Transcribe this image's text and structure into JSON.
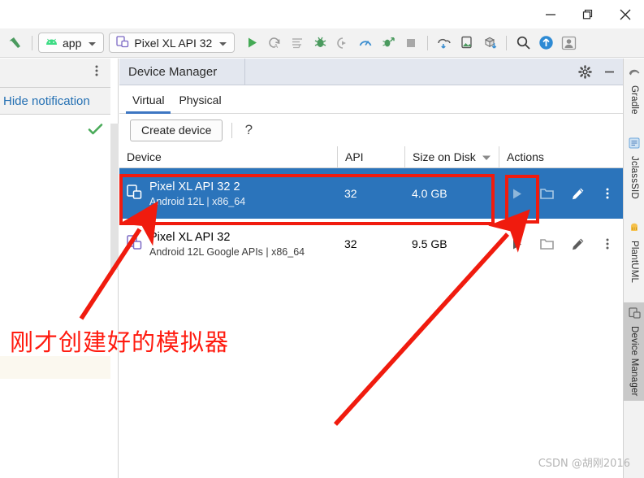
{
  "window": {
    "controls": [
      {
        "name": "minimize-button",
        "glyph": "minimize"
      },
      {
        "name": "restore-button",
        "glyph": "restore"
      },
      {
        "name": "close-button",
        "glyph": "close"
      }
    ]
  },
  "toolbar": {
    "build_icon": "hammer-icon",
    "module_selector": {
      "label": "app",
      "icon": "android-icon"
    },
    "device_selector": {
      "label": "Pixel XL API 32",
      "icon": "device-icon"
    },
    "icons": [
      "run-icon",
      "apply-changes-icon",
      "apply-code-changes-icon",
      "debug-icon",
      "attach-debugger-icon",
      "profiler-icon",
      "run-with-coverage-icon",
      "stop-icon",
      "sdk-manager-icon",
      "avd-manager-icon",
      "sync-project-icon",
      "search-icon",
      "update-icon",
      "account-icon"
    ]
  },
  "notification_panel": {
    "hide_label": "Hide notification",
    "more_icon": "more-vertical-icon",
    "status_icon": "check-icon"
  },
  "device_manager": {
    "title": "Device Manager",
    "settings_icon": "gear-icon",
    "minimize_icon": "minimize-icon",
    "tabs": [
      {
        "label": "Virtual",
        "active": true
      },
      {
        "label": "Physical",
        "active": false
      }
    ],
    "create_button": "Create device",
    "help_label": "?",
    "columns": [
      {
        "key": "device",
        "label": "Device"
      },
      {
        "key": "api",
        "label": "API"
      },
      {
        "key": "size",
        "label": "Size on Disk",
        "sorted": true,
        "sort_icon": "sort-desc-icon"
      },
      {
        "key": "actions",
        "label": "Actions"
      }
    ],
    "rows": [
      {
        "name": "Pixel XL API 32 2",
        "detail": "Android 12L | x86_64",
        "api": "32",
        "size": "4.0 GB",
        "selected": true,
        "icon": "virtual-device-icon",
        "actions": [
          "run-icon",
          "folder-icon",
          "edit-icon",
          "menu-icon"
        ]
      },
      {
        "name": "Pixel XL API 32",
        "detail": "Android 12L Google APIs | x86_64",
        "api": "32",
        "size": "9.5 GB",
        "selected": false,
        "icon": "virtual-device-icon",
        "actions": [
          "run-icon",
          "folder-icon",
          "edit-icon",
          "menu-icon"
        ]
      }
    ]
  },
  "right_tool_tabs": [
    {
      "label": "Gradle",
      "icon": "gradle-icon",
      "active": false
    },
    {
      "label": "JclassSID",
      "icon": "jclass-icon",
      "active": false
    },
    {
      "label": "PlantUML",
      "icon": "plantuml-icon",
      "active": false
    },
    {
      "label": "Device Manager",
      "icon": "device-manager-icon",
      "active": true
    }
  ],
  "annotations": {
    "note_text": "刚才创建好的模拟器",
    "highlight_color": "#f01b0e",
    "arrow_color": "#f01b0e"
  },
  "watermark": "CSDN @胡刚2016"
}
